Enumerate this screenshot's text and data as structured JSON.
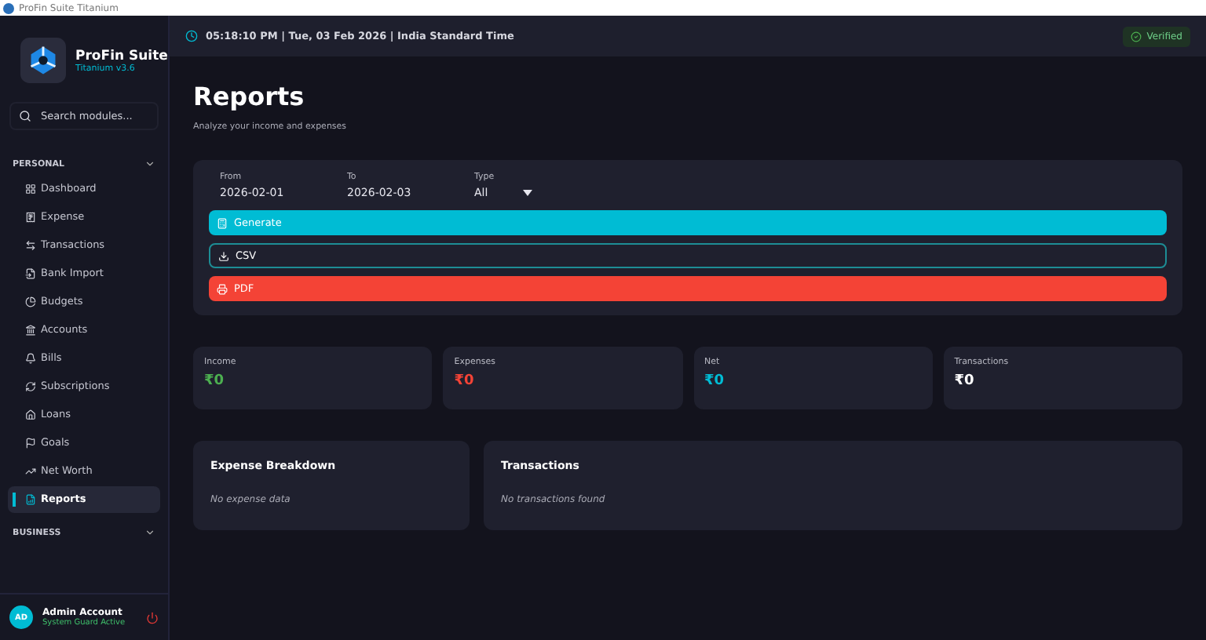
{
  "window": {
    "title": "ProFin Suite Titanium"
  },
  "brand": {
    "name": "ProFin Suite",
    "version": "Titanium v3.6"
  },
  "search": {
    "placeholder": "Search modules..."
  },
  "sidebar": {
    "sections": [
      {
        "title": "PERSONAL",
        "expanded": true,
        "items": [
          {
            "label": "Dashboard",
            "selected": false
          },
          {
            "label": "Expense",
            "selected": false
          },
          {
            "label": "Transactions",
            "selected": false
          },
          {
            "label": "Bank Import",
            "selected": false
          },
          {
            "label": "Budgets",
            "selected": false
          },
          {
            "label": "Accounts",
            "selected": false
          },
          {
            "label": "Bills",
            "selected": false
          },
          {
            "label": "Subscriptions",
            "selected": false
          },
          {
            "label": "Loans",
            "selected": false
          },
          {
            "label": "Goals",
            "selected": false
          },
          {
            "label": "Net Worth",
            "selected": false
          },
          {
            "label": "Reports",
            "selected": true
          }
        ]
      },
      {
        "title": "BUSINESS",
        "expanded": true
      }
    ]
  },
  "user": {
    "initials": "AD",
    "name": "Admin Account",
    "status": "System Guard Active"
  },
  "header": {
    "datetime": "05:18:10 PM | Tue, 03 Feb 2026 | India Standard Time",
    "badge": "Verified"
  },
  "page": {
    "title": "Reports",
    "subtitle": "Analyze your income and expenses"
  },
  "filters": [
    {
      "label": "From",
      "value": "2026-02-01",
      "kind": "date"
    },
    {
      "label": "To",
      "value": "2026-02-03",
      "kind": "date"
    },
    {
      "label": "Type",
      "value": "All",
      "kind": "select"
    }
  ],
  "actions": [
    {
      "label": "Generate",
      "kind": "primary"
    },
    {
      "label": "CSV",
      "kind": "outline"
    },
    {
      "label": "PDF",
      "kind": "danger"
    }
  ],
  "stats": [
    {
      "label": "Income",
      "value": "₹0",
      "color": "#4caf50"
    },
    {
      "label": "Expenses",
      "value": "₹0",
      "color": "#f44336"
    },
    {
      "label": "Net",
      "value": "₹0",
      "color": "#00bcd4"
    },
    {
      "label": "Transactions",
      "value": "₹0",
      "color": "#ffffff"
    }
  ],
  "panels": [
    {
      "title": "Expense Breakdown",
      "empty": "No expense data"
    },
    {
      "title": "Transactions",
      "empty": "No transactions found"
    }
  ]
}
